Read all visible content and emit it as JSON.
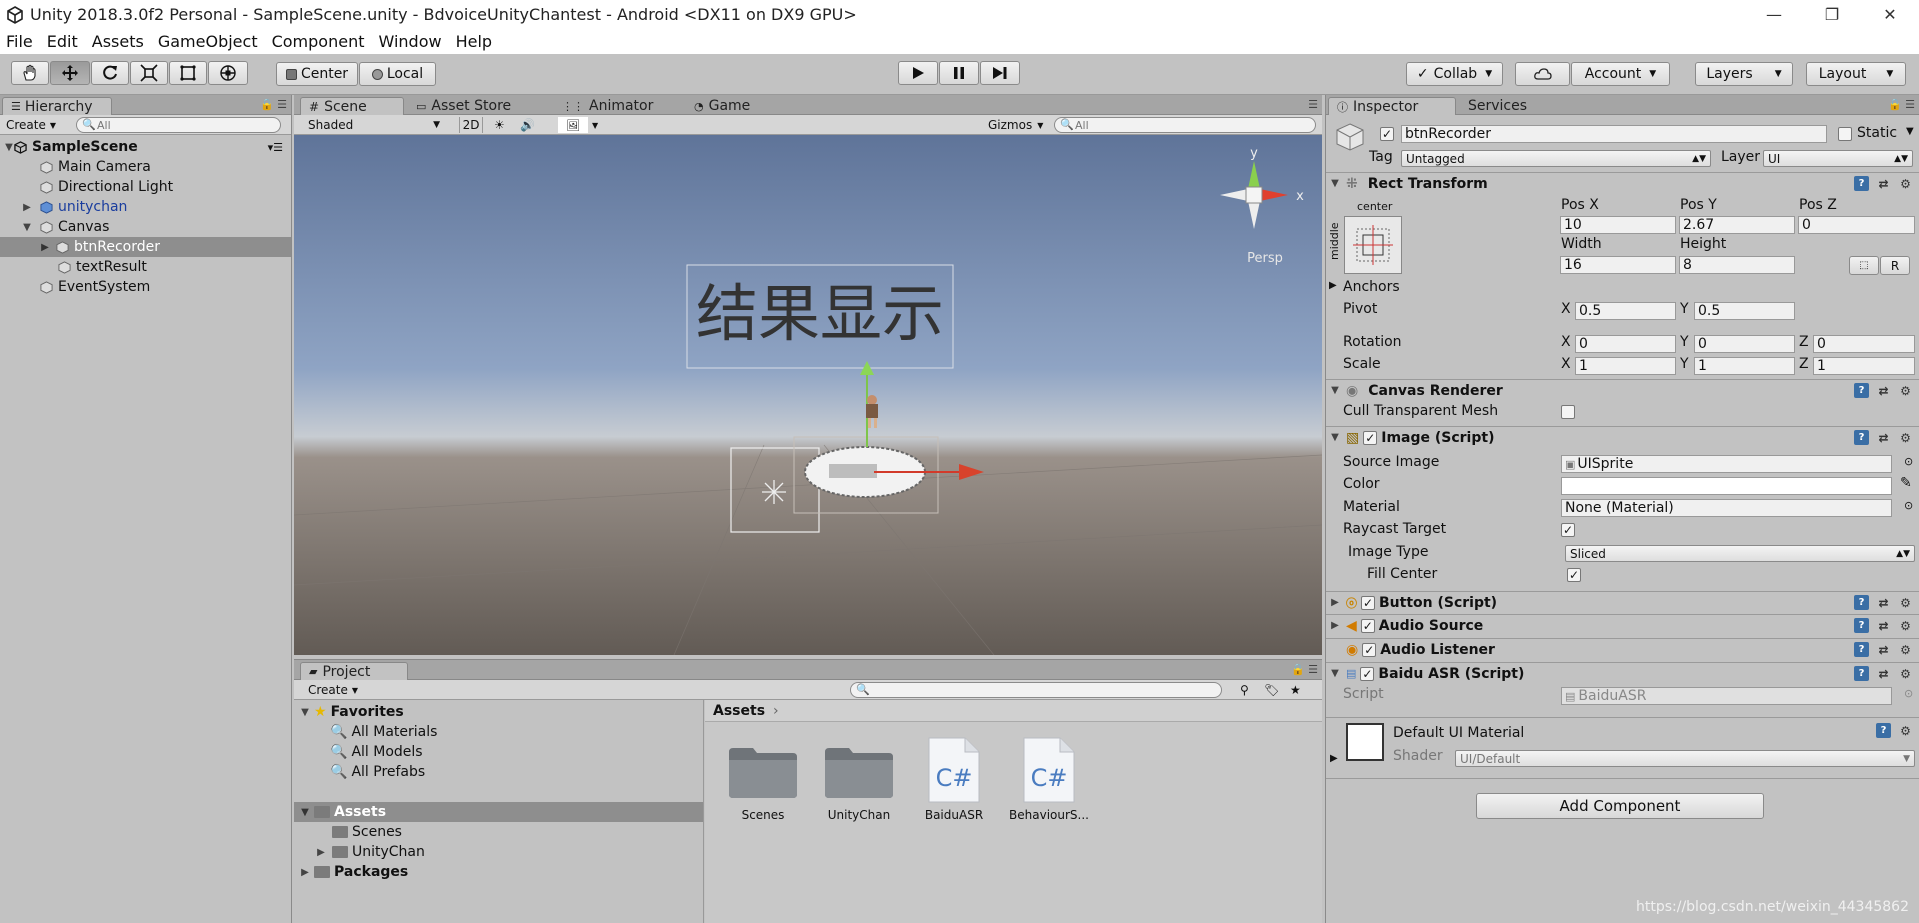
{
  "window": {
    "title": "Unity 2018.3.0f2 Personal - SampleScene.unity - BdvoiceUnityChantest - Android <DX11 on DX9 GPU>",
    "controls": [
      "—",
      "❐",
      "✕"
    ]
  },
  "menu": [
    "File",
    "Edit",
    "Assets",
    "GameObject",
    "Component",
    "Window",
    "Help"
  ],
  "toolbar": {
    "pivot_mode": "Center",
    "pivot_rotation": "Local",
    "collab": "Collab",
    "account": "Account",
    "layers": "Layers",
    "layout": "Layout"
  },
  "hierarchy": {
    "tab": "Hierarchy",
    "create": "Create",
    "search_placeholder": "All",
    "scene": "SampleScene",
    "items": [
      {
        "label": "Main Camera"
      },
      {
        "label": "Directional Light"
      },
      {
        "label": "unitychan"
      },
      {
        "label": "Canvas"
      },
      {
        "label": "btnRecorder"
      },
      {
        "label": "textResult"
      },
      {
        "label": "EventSystem"
      }
    ]
  },
  "scene": {
    "tabs": [
      "Scene",
      "Asset Store",
      "Animator",
      "Game"
    ],
    "shading": "Shaded",
    "mode_2d": "2D",
    "gizmos": "Gizmos",
    "search_placeholder": "All",
    "world_text": "结果显示",
    "persp": "Persp",
    "axis_y": "y",
    "axis_x": "x"
  },
  "project": {
    "tab": "Project",
    "create": "Create",
    "favorites": "Favorites",
    "favorite_items": [
      "All Materials",
      "All Models",
      "All Prefabs"
    ],
    "assets_root": "Assets",
    "asset_folders": [
      "Scenes",
      "UnityChan"
    ],
    "packages": "Packages",
    "breadcrumb": "Assets",
    "grid_items": [
      {
        "label": "Scenes",
        "kind": "folder"
      },
      {
        "label": "UnityChan",
        "kind": "folder"
      },
      {
        "label": "BaiduASR",
        "kind": "script"
      },
      {
        "label": "BehaviourS...",
        "kind": "script"
      }
    ],
    "cs_glyph": "C#"
  },
  "inspector": {
    "tabs": [
      "Inspector",
      "Services"
    ],
    "object_name": "btnRecorder",
    "static_label": "Static",
    "tag_label": "Tag",
    "tag_value": "Untagged",
    "layer_label": "Layer",
    "layer_value": "UI",
    "rect_transform": {
      "title": "Rect Transform",
      "anchor_h": "center",
      "anchor_v": "middle",
      "pos_x_label": "Pos X",
      "pos_y_label": "Pos Y",
      "pos_z_label": "Pos Z",
      "pos_x": "10",
      "pos_y": "2.67",
      "pos_z": "0",
      "width_label": "Width",
      "height_label": "Height",
      "width": "16",
      "height": "8",
      "r_button": "R",
      "anchors": "Anchors",
      "pivot_label": "Pivot",
      "pivot_x": "0.5",
      "pivot_y": "0.5",
      "rotation_label": "Rotation",
      "rot_x": "0",
      "rot_y": "0",
      "rot_z": "0",
      "scale_label": "Scale",
      "scale_x": "1",
      "scale_y": "1",
      "scale_z": "1",
      "x": "X",
      "y": "Y",
      "z": "Z"
    },
    "canvas_renderer": {
      "title": "Canvas Renderer",
      "cull_label": "Cull Transparent Mesh"
    },
    "image": {
      "title": "Image (Script)",
      "source_label": "Source Image",
      "source_value": "UISprite",
      "color_label": "Color",
      "material_label": "Material",
      "material_value": "None (Material)",
      "raycast_label": "Raycast Target",
      "type_label": "Image Type",
      "type_value": "Sliced",
      "fill_label": "Fill Center"
    },
    "components": [
      "Button (Script)",
      "Audio Source",
      "Audio Listener",
      "Baidu ASR (Script)"
    ],
    "baidu_script_label": "Script",
    "baidu_script_value": "BaiduASR",
    "material": {
      "title": "Default UI Material",
      "shader_label": "Shader",
      "shader_value": "UI/Default"
    },
    "add_component": "Add Component"
  },
  "watermark": "https://blog.csdn.net/weixin_44345862"
}
